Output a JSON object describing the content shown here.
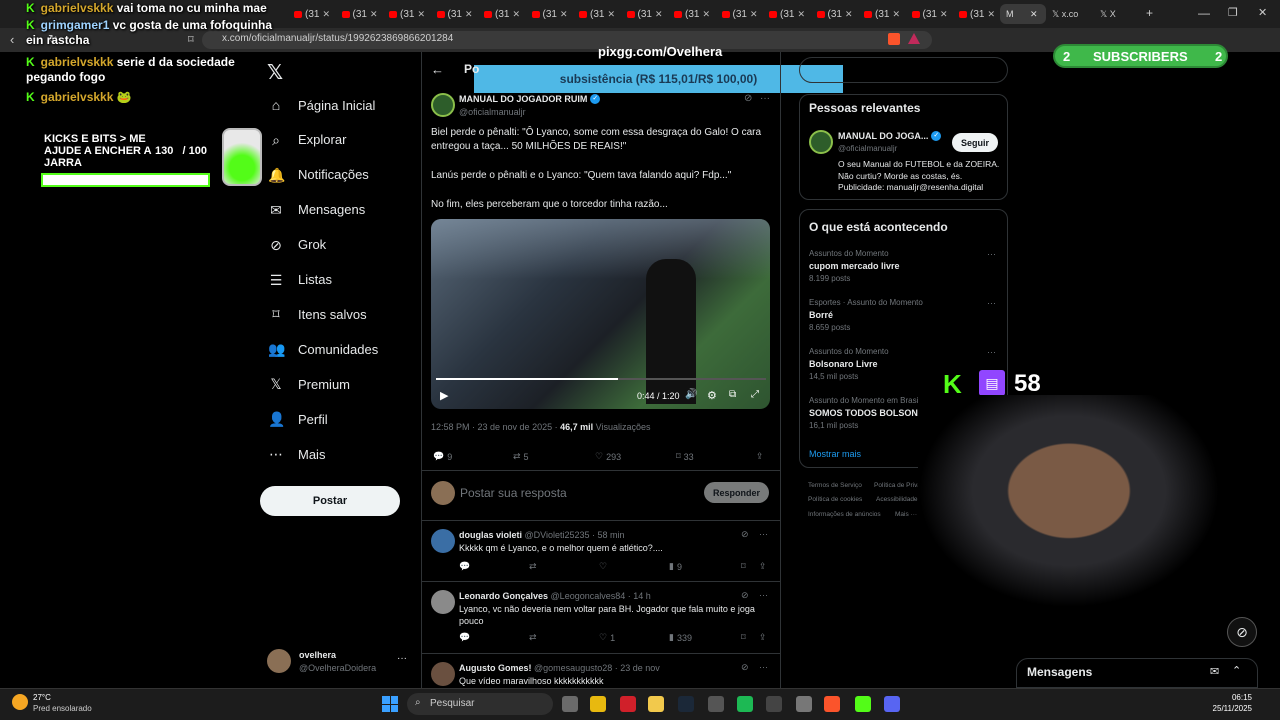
{
  "browser": {
    "tabs": [
      {
        "label": "(31"
      },
      {
        "label": "(31"
      },
      {
        "label": "(31"
      },
      {
        "label": "(31"
      },
      {
        "label": "(31"
      },
      {
        "label": "(31"
      },
      {
        "label": "(31"
      },
      {
        "label": "(31"
      },
      {
        "label": "(31"
      },
      {
        "label": "(31"
      },
      {
        "label": "(31"
      },
      {
        "label": "(31"
      },
      {
        "label": "(31"
      },
      {
        "label": "(31"
      },
      {
        "label": "(31"
      }
    ],
    "active_tab": "M",
    "tab_x1": "x.co",
    "tab_x2": "X",
    "url": "x.com/oficialmanualjr/status/1992623869866201284",
    "accent": "#1d9bf0"
  },
  "stream": {
    "chat": [
      {
        "user": "gabrielvskkk",
        "msg": "vai toma no cu minha mae"
      },
      {
        "user": "grimgamer1",
        "msg": "vc gosta de uma fofoquinha ein rastcha"
      },
      {
        "user": "gabrielvskkk",
        "msg": "serie d da sociedade pegando fogo"
      },
      {
        "user": "gabrielvskkk",
        "msg": "🐸"
      }
    ],
    "goal_text": "KICKS E BITS > ME AJUDE A ENCHER A JARRA",
    "goal_current": "130",
    "goal_target": "/ 100",
    "pixgg": "pixgg.com/Ovelhera",
    "subsistencia": "subsistência (R$ 115,01/R$ 100,00)",
    "subs_left": "2",
    "subs_label": "SUBSCRIBERS",
    "subs_right": "2",
    "viewer_count": "58"
  },
  "nav": {
    "items": [
      {
        "label": "Página Inicial",
        "icon": "home-icon"
      },
      {
        "label": "Explorar",
        "icon": "search-icon"
      },
      {
        "label": "Notificações",
        "icon": "bell-icon"
      },
      {
        "label": "Mensagens",
        "icon": "mail-icon"
      },
      {
        "label": "Grok",
        "icon": "grok-icon"
      },
      {
        "label": "Listas",
        "icon": "list-icon"
      },
      {
        "label": "Itens salvos",
        "icon": "bookmark-icon"
      },
      {
        "label": "Comunidades",
        "icon": "people-icon"
      },
      {
        "label": "Premium",
        "icon": "x-icon"
      },
      {
        "label": "Perfil",
        "icon": "user-icon"
      },
      {
        "label": "Mais",
        "icon": "more-icon"
      }
    ],
    "post_label": "Postar",
    "account_name": "ovelhera",
    "account_handle": "@OvelheraDoidera"
  },
  "post": {
    "header": "Po",
    "author": "MANUAL DO JOGADOR RUIM",
    "handle": "@oficialmanualjr",
    "text1": "Biel perde o pênalti: \"Ô Lyanco, some com essa desgraça do Galo! O cara entregou a taça... 50 MILHÕES DE REAIS!\"",
    "text2": "Lanús perde o pênalti e o Lyanco: \"Quem tava falando aqui? Fdp...\"",
    "text3": "No fim, eles perceberam que o torcedor tinha razão...",
    "video_time": "0:44 / 1:20",
    "timestamp": "12:58 PM · 23 de nov de 2025 · ",
    "views": "46,7 mil",
    "views_label": " Visualizações",
    "replies": "9",
    "reposts": "5",
    "likes": "293",
    "bookmarks": "33",
    "reply_placeholder": "Postar sua resposta",
    "reply_button": "Responder"
  },
  "replies": [
    {
      "name": "douglas violeti",
      "meta": "@DVioleti25235 · 58 min",
      "text": "Kkkkk qm é Lyanco, e o melhor quem é atlético?....",
      "views": "9",
      "likes": ""
    },
    {
      "name": "Leonardo Gonçalves",
      "meta": "@Leogoncalves84 · 14 h",
      "text": "Lyanco, vc não deveria nem voltar para BH. Jogador que fala muito e joga pouco",
      "views": "339",
      "likes": "1"
    },
    {
      "name": "Augusto Gomes!",
      "meta": "@gomesaugusto28 · 23 de nov",
      "text": "Que vídeo maravilhoso kkkkkkkkkkk",
      "views": "",
      "likes": ""
    }
  ],
  "sidebar": {
    "relevant_title": "Pessoas relevantes",
    "relevant_name": "MANUAL DO JOGA...",
    "relevant_handle": "@oficialmanualjr",
    "follow": "Seguir",
    "bio": "O seu Manual do FUTEBOL e da ZOEIRA. Não curtiu? Morde as costas, és. Publicidade: manualjr@resenha.digital",
    "trends_title": "O que está acontecendo",
    "trends": [
      {
        "context": "Assuntos do Momento",
        "name": "cupom mercado livre",
        "count": "8.199 posts"
      },
      {
        "context": "Esportes · Assunto do Momento",
        "name": "Borré",
        "count": "8.659 posts"
      },
      {
        "context": "Assuntos do Momento",
        "name": "Bolsonaro Livre",
        "count": "14,5 mil posts"
      },
      {
        "context": "Assunto do Momento em Brasil",
        "name": "SOMOS TODOS BOLSONARO",
        "count": "16,1 mil posts"
      }
    ],
    "show_more": "Mostrar mais",
    "footer": [
      "Termos de Serviço",
      "Política de Privacidade",
      "Política de cookies",
      "Acessibilidade",
      "Informações de anúncios",
      "Mais ···",
      "© 2025 X Corp."
    ],
    "messages": "Mensagens"
  },
  "taskbar": {
    "temp": "27°C",
    "weather": "Pred ensolarado",
    "search": "Pesquisar",
    "time": "06:15",
    "date": "25/11/2025"
  }
}
